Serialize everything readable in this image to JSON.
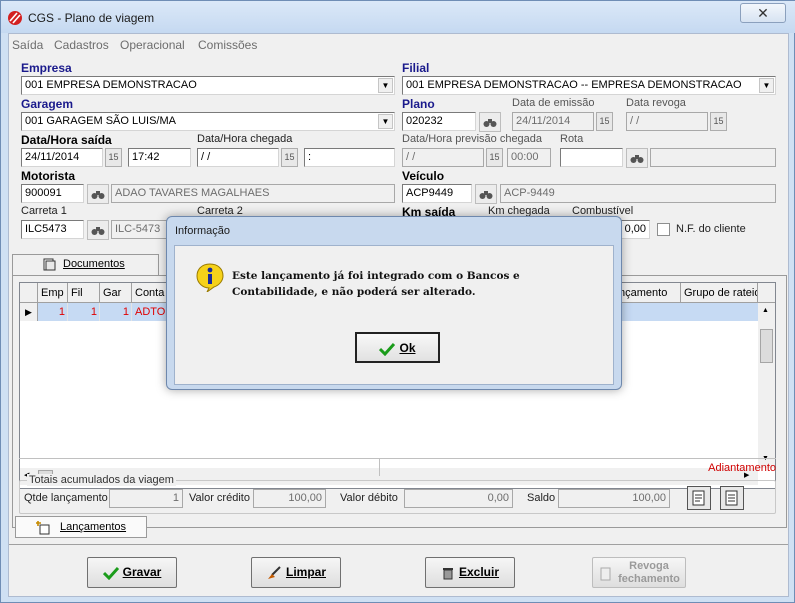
{
  "window": {
    "title": "CGS - Plano de viagem",
    "close_glyph": "✕"
  },
  "menu": [
    "Saída",
    "Cadastros",
    "Operacional",
    "Comissões"
  ],
  "form": {
    "empresa": {
      "label": "Empresa",
      "value": "001 EMPRESA DEMONSTRACAO"
    },
    "filial": {
      "label": "Filial",
      "value": "001 EMPRESA DEMONSTRACAO -- EMPRESA DEMONSTRACAO"
    },
    "garagem": {
      "label": "Garagem",
      "value": "001 GARAGEM SÃO LUIS/MA"
    },
    "plano": {
      "label": "Plano",
      "value": "020232"
    },
    "data_emissao": {
      "label": "Data de emissão",
      "value": "24/11/2014"
    },
    "data_revoga": {
      "label": "Data revoga",
      "value": " /  /"
    },
    "saida": {
      "label": "Data/Hora saída",
      "date": "24/11/2014",
      "time": "17:42"
    },
    "chegada": {
      "label": "Data/Hora chegada",
      "date": " /  /",
      "time": ":"
    },
    "previsao": {
      "label": "Data/Hora previsão chegada",
      "date": " /  /",
      "time": "00:00"
    },
    "rota": {
      "label": "Rota",
      "value": ""
    },
    "motorista": {
      "label": "Motorista",
      "code": "900091",
      "name": "ADAO TAVARES MAGALHAES"
    },
    "veiculo": {
      "label": "Veículo",
      "code": "ACP9449",
      "name": "ACP-9449"
    },
    "carreta1": {
      "label": "Carreta 1",
      "code": "ILC5473",
      "name": "ILC-5473"
    },
    "carreta2": {
      "label": "Carreta 2"
    },
    "km_saida": {
      "label": "Km saída"
    },
    "km_chegada": {
      "label": "Km chegada"
    },
    "combustivel": {
      "label": "Combustível",
      "value": "0,00"
    },
    "nf_cliente": {
      "label": "N.F. do cliente",
      "checked": false
    },
    "calendar_glyph": "15"
  },
  "tabs": {
    "top": "Documentos",
    "bottom": "Lançamentos"
  },
  "grid": {
    "columns": [
      "Emp",
      "Fil",
      "Gar",
      "Conta",
      "nçamento",
      "Grupo de rateio"
    ],
    "rows": [
      {
        "emp": "1",
        "fil": "1",
        "gar": "1",
        "conta": "ADTO"
      }
    ],
    "footer_status": "Adiantamento"
  },
  "totais": {
    "title": "Totais acumulados da viagem",
    "qtde_label": "Qtde lançamento",
    "qtde_value": "1",
    "credito_label": "Valor crédito",
    "credito_value": "100,00",
    "debito_label": "Valor débito",
    "debito_value": "0,00",
    "saldo_label": "Saldo",
    "saldo_value": "100,00"
  },
  "buttons": {
    "gravar": "Gravar",
    "limpar": "Limpar",
    "excluir": "Excluir",
    "revoga_line1": "Revoga",
    "revoga_line2": "fechamento"
  },
  "dialog": {
    "title": "Informação",
    "message": "Este lançamento já foi integrado com o Bancos e Contabilidade, e não poderá ser alterado.",
    "ok_label": "Ok",
    "icon": "info-icon"
  },
  "colors": {
    "accent_label": "#1a1a8c",
    "row_text": "#e00000",
    "selected_row": "#c6daf3"
  }
}
